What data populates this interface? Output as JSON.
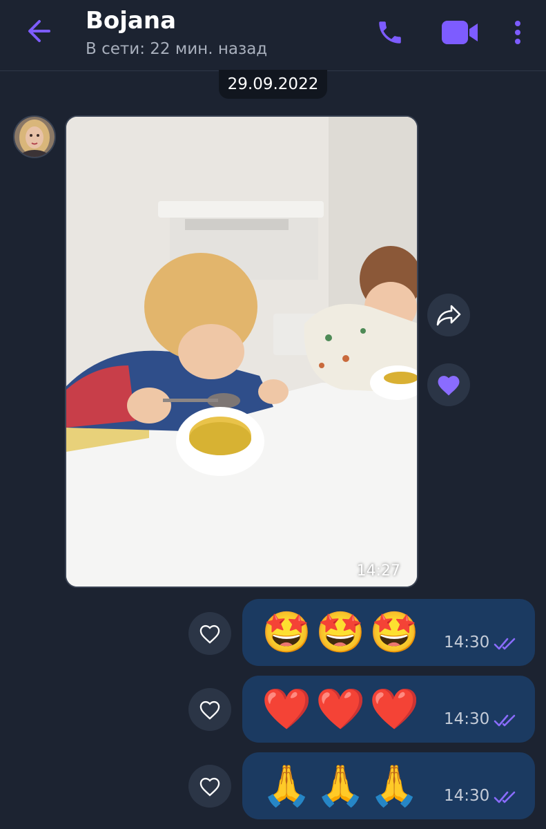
{
  "header": {
    "title": "Bojana",
    "status": "В сети: 22 мин. назад"
  },
  "icons": {
    "back": "arrow-left-icon",
    "call": "phone-icon",
    "video": "video-camera-icon",
    "more": "more-vertical-icon",
    "forward": "forward-share-icon",
    "like": "heart-icon",
    "read": "double-check-icon"
  },
  "colors": {
    "accent": "#7d5cff",
    "background": "#1c2331",
    "outgoing_bubble": "#1b3a61",
    "round_button": "#2b3546"
  },
  "conversation": {
    "date": "29.09.2022",
    "photo_message": {
      "time": "14:27",
      "liked": true
    },
    "outgoing": [
      {
        "emojis": "🤩🤩🤩",
        "time": "14:30"
      },
      {
        "emojis": "❤️❤️❤️",
        "time": "14:30"
      },
      {
        "emojis": "🙏🙏🙏",
        "time": "14:30"
      }
    ]
  }
}
